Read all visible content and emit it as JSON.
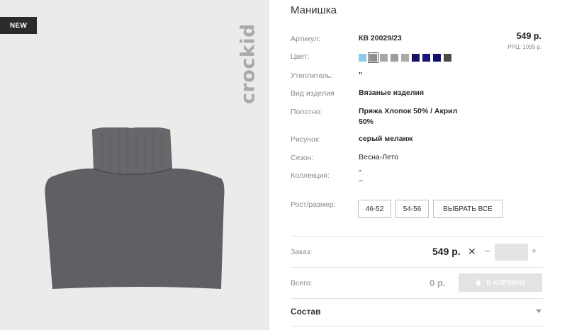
{
  "badge": {
    "new": "NEW"
  },
  "brand": {
    "logo_text": "crockid"
  },
  "product": {
    "title": "Манишка",
    "price": "549 р.",
    "rrp": "РРЦ: 1099 р."
  },
  "attributes": {
    "article": {
      "label": "Артикул:",
      "value": "КВ 20029/23"
    },
    "color": {
      "label": "Цвет:",
      "swatches": [
        "#8ec8ea",
        "#8f8f8f",
        "#a6a6a6",
        "#9d9d9d",
        "#a9a9a9",
        "#15125e",
        "#1a1676",
        "#14106a",
        "#4a4a4a"
      ],
      "selected_index": 1
    },
    "insulation": {
      "label": "Утеплитель:",
      "value": "\""
    },
    "item_type": {
      "label": "Вид изделия",
      "value": "Вязаные изделия"
    },
    "fabric": {
      "label": "Полотно:",
      "value_line1": "Пряжа Хлопок 50% / Акрил",
      "value_line2": "50%"
    },
    "pattern": {
      "label": "Рисунок:",
      "value": "серый меланж"
    },
    "season": {
      "label": "Сезон:",
      "value": "Весна-Лето"
    },
    "collection": {
      "label": "Коллекция:",
      "value_line1": "\"",
      "value_line2": "–"
    }
  },
  "sizes": {
    "label": "Рост/размер:",
    "options": [
      "46-52",
      "54-56"
    ],
    "select_all": "ВЫБРАТЬ ВСЕ"
  },
  "order": {
    "label": "Заказ:",
    "price": "549 р.",
    "remove_glyph": "✕",
    "minus_glyph": "–",
    "plus_glyph": "+",
    "quantity": ""
  },
  "total": {
    "label": "Всего:",
    "value": "0 р.",
    "cart_button": "В КОРЗИНУ"
  },
  "composition": {
    "title": "Состав"
  },
  "icons": [
    "product-photo",
    "cart-icon",
    "chevron-down-icon",
    "close-icon",
    "minus-icon",
    "plus-icon"
  ]
}
